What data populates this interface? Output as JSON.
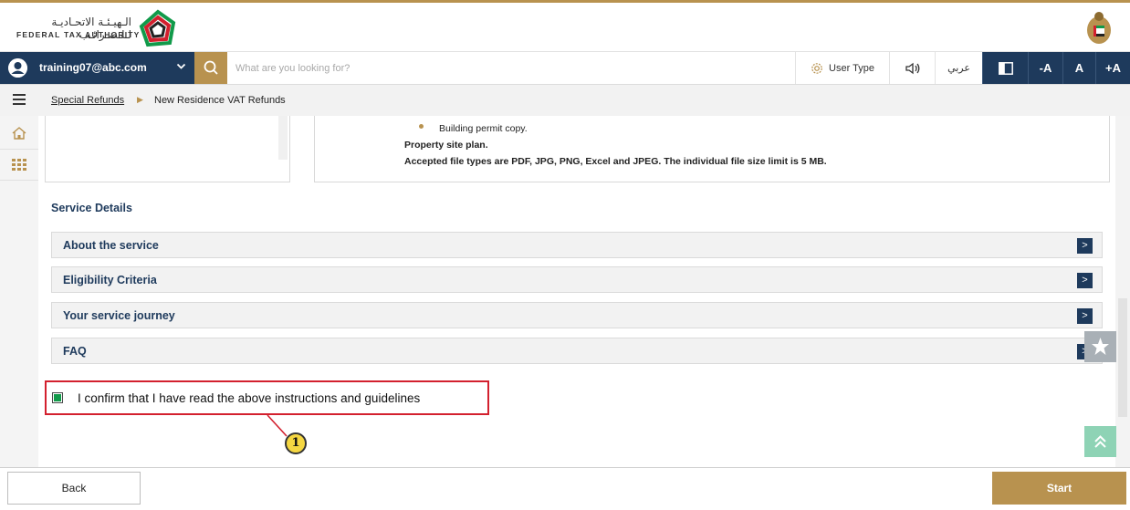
{
  "header": {
    "logo_text_ar": "الـهيـئـة الاتحـاديـة لـلـضـرائـب",
    "logo_text_en": "FEDERAL TAX AUTHORITY",
    "brand_colors": {
      "gold": "#b8924f",
      "navy": "#1e3a5c",
      "green": "#119a4a",
      "red": "#d3202e"
    }
  },
  "toolbar": {
    "user_email": "training07@abc.com",
    "search_placeholder": "What are you looking for?",
    "user_type_label": "User Type",
    "language_label": "عربي",
    "font_decrease_label": "-A",
    "font_normal_label": "A",
    "font_increase_label": "+A"
  },
  "breadcrumb": {
    "parent": "Special Refunds",
    "current": "New Residence VAT Refunds"
  },
  "requirements": {
    "bullet_item": "Building permit copy.",
    "line1": "Property site plan.",
    "line2": "Accepted file types are PDF, JPG, PNG, Excel and JPEG. The individual file size limit is 5 MB."
  },
  "service_details": {
    "title": "Service Details",
    "items": [
      {
        "label": "About the service",
        "expand_icon": ">"
      },
      {
        "label": "Eligibility Criteria",
        "expand_icon": ">"
      },
      {
        "label": "Your service journey",
        "expand_icon": ">"
      },
      {
        "label": "FAQ",
        "expand_icon": ">"
      }
    ]
  },
  "confirmation": {
    "checked": true,
    "label": "I confirm that I have read the above instructions and guidelines"
  },
  "annotation": {
    "number": "1"
  },
  "footer": {
    "back_label": "Back",
    "start_label": "Start"
  }
}
